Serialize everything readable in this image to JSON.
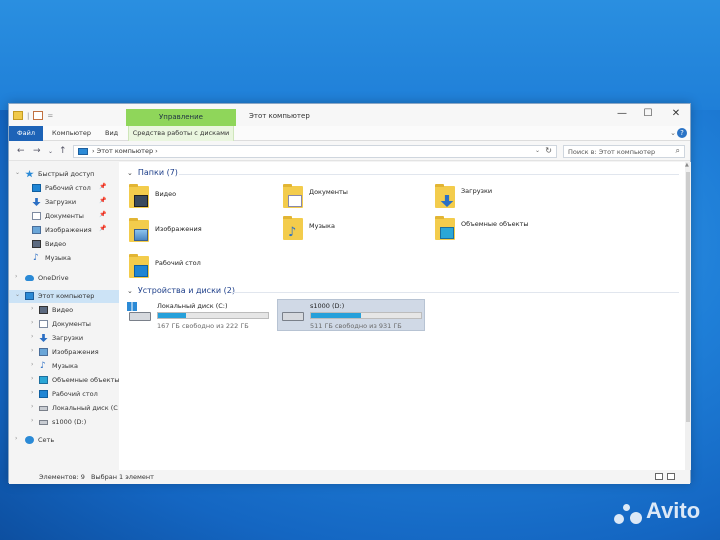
{
  "window": {
    "title": "Этот компьютер",
    "manage_tab": "Управление",
    "buttons": {
      "minimize": "—",
      "maximize": "☐",
      "close": "✕"
    }
  },
  "menu": {
    "file": "Файл",
    "computer": "Компьютер",
    "view": "Вид",
    "disk_tools": "Средства работы с дисками"
  },
  "address": {
    "crumb": "Этот компьютер",
    "search_placeholder": "Поиск в: Этот компьютер"
  },
  "navpane": {
    "quick_access": "Быстрый доступ",
    "quick_items": [
      "Рабочий стол",
      "Загрузки",
      "Документы",
      "Изображения",
      "Видео",
      "Музыка"
    ],
    "onedrive": "OneDrive",
    "this_pc": "Этот компьютер",
    "pc_items": [
      "Видео",
      "Документы",
      "Загрузки",
      "Изображения",
      "Музыка",
      "Объемные объекты",
      "Рабочий стол",
      "Локальный диск (С",
      "s1000 (D:)"
    ],
    "network": "Сеть"
  },
  "content": {
    "folders_header": "Папки (7)",
    "folders": [
      "Видео",
      "Документы",
      "Загрузки",
      "Изображения",
      "Музыка",
      "Объемные объекты",
      "Рабочий стол"
    ],
    "devices_header": "Устройства и диски (2)",
    "drives": [
      {
        "name": "Локальный диск (C:)",
        "free_text": "167 ГБ свободно из 222 ГБ",
        "used_fraction": 0.25
      },
      {
        "name": "s1000 (D:)",
        "free_text": "511 ГБ свободно из 931 ГБ",
        "used_fraction": 0.45
      }
    ]
  },
  "status": {
    "items": "Элементов: 9",
    "selected": "Выбран 1 элемент"
  },
  "watermark": "Avito",
  "colors": {
    "accent": "#1d63b7",
    "manage_green": "#8fd65a",
    "drive_bar": "#26a0da"
  }
}
